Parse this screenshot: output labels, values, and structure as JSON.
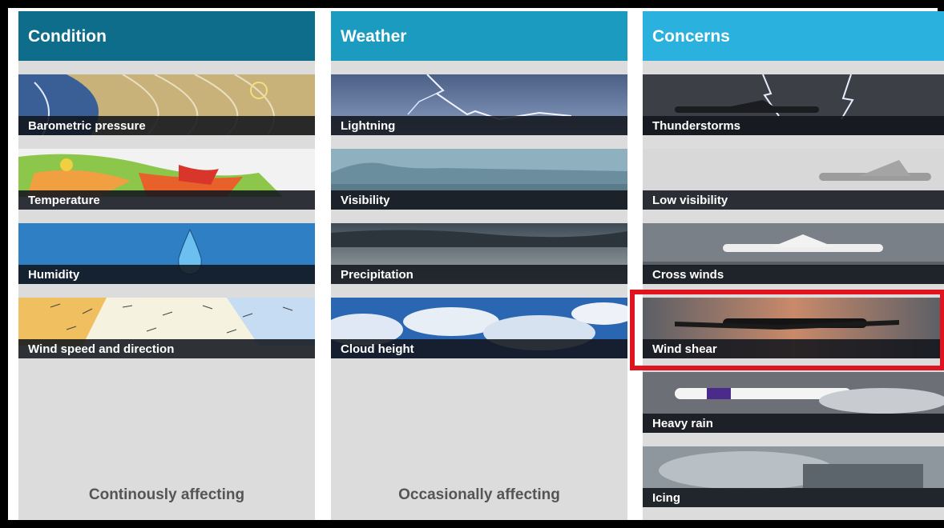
{
  "columns": [
    {
      "header": "Condition",
      "header_color": "#0e6d8a",
      "items": [
        "Barometric pressure",
        "Temperature",
        "Humidity",
        "Wind speed and direction"
      ],
      "footer": "Continously affecting"
    },
    {
      "header": "Weather",
      "header_color": "#1a9bbf",
      "items": [
        "Lightning",
        "Visibility",
        "Precipitation",
        "Cloud height"
      ],
      "footer": "Occasionally affecting"
    },
    {
      "header": "Concerns",
      "header_color": "#2ab1de",
      "items": [
        "Thunderstorms",
        "Low visibility",
        "Cross winds",
        "Wind shear",
        "Heavy rain",
        "Icing"
      ]
    }
  ],
  "highlighted_item": "Wind shear",
  "colors": {
    "highlight": "#e0141e",
    "column_bg": "#dcdcdc",
    "label_bg": "#12161c"
  }
}
